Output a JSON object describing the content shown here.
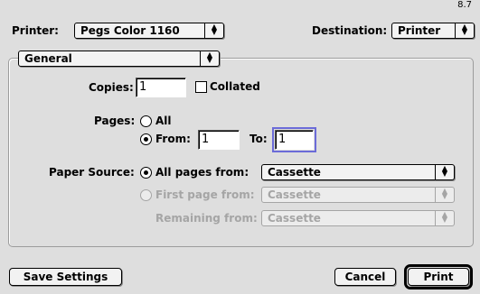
{
  "version": "8.7",
  "printer": {
    "label": "Printer:",
    "value": "Pegs Color 1160"
  },
  "destination": {
    "label": "Destination:",
    "value": "Printer"
  },
  "panel": {
    "value": "General"
  },
  "copies": {
    "label": "Copies:",
    "value": "1",
    "collated_label": "Collated",
    "collated_checked": false
  },
  "pages": {
    "label": "Pages:",
    "all_label": "All",
    "from_label": "From:",
    "from_value": "1",
    "to_label": "To:",
    "to_value": "1",
    "selected": "from"
  },
  "paper_source": {
    "label": "Paper Source:",
    "all_pages_label": "All pages from:",
    "all_pages_value": "Cassette",
    "first_page_label": "First page from:",
    "first_page_value": "Cassette",
    "remaining_label": "Remaining from:",
    "remaining_value": "Cassette",
    "selected": "all_pages"
  },
  "buttons": {
    "save_settings": "Save Settings",
    "cancel": "Cancel",
    "print": "Print"
  },
  "icons": {
    "popup_arrow": "updown-arrow-icon"
  }
}
